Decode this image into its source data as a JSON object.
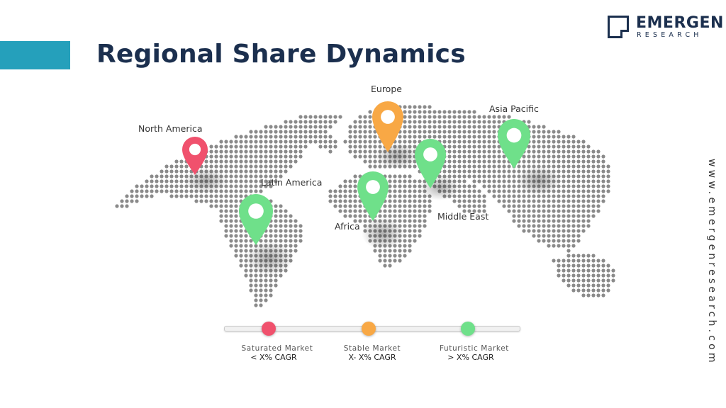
{
  "header": {
    "title": "Regional Share Dynamics",
    "accent_color": "#25a0bb",
    "title_color": "#1b2f4e"
  },
  "logo": {
    "main": "EMERGEN",
    "sub": "RESEARCH"
  },
  "website": "www.emergenresearch.com",
  "regions": [
    {
      "name": "North America",
      "status": "saturated",
      "color": "#f0516d"
    },
    {
      "name": "Europe",
      "status": "stable",
      "color": "#f8a845"
    },
    {
      "name": "Asia Pacific",
      "status": "futuristic",
      "color": "#6fe08a"
    },
    {
      "name": "Latin America",
      "status": "futuristic",
      "color": "#6fe08a"
    },
    {
      "name": "Middle East",
      "status": "futuristic",
      "color": "#6fe08a"
    },
    {
      "name": "Africa",
      "status": "futuristic",
      "color": "#6fe08a"
    }
  ],
  "legend": [
    {
      "title": "Saturated Market",
      "sub": "< X% CAGR",
      "color": "#f0516d"
    },
    {
      "title": "Stable Market",
      "sub": "X- X% CAGR",
      "color": "#f8a845"
    },
    {
      "title": "Futuristic Market",
      "sub": "> X% CAGR",
      "color": "#6fe08a"
    }
  ]
}
